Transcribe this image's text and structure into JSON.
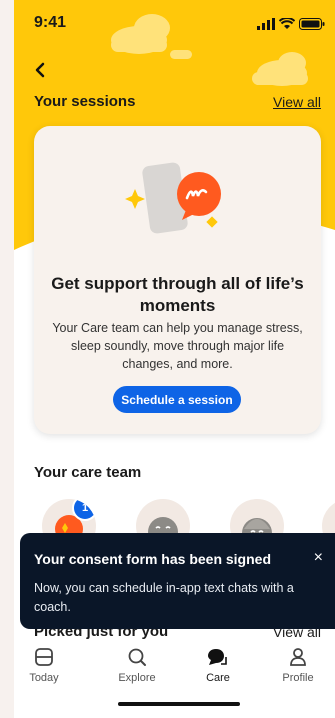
{
  "status_bar": {
    "time": "9:41"
  },
  "header": {
    "sessions_title": "Your sessions",
    "view_all": "View all"
  },
  "card": {
    "title": "Get support through all of life’s moments",
    "body": "Your Care team can help you manage stress, sleep soundly, move through major life changes, and more.",
    "button": "Schedule a session"
  },
  "team": {
    "title": "Your care team",
    "badge_count": "1"
  },
  "toast": {
    "title": "Your consent form has been signed",
    "body": "Now, you can schedule in-app text chats with a coach.",
    "close": "×"
  },
  "picked": {
    "title": "Picked just for you",
    "view_all": "View all"
  },
  "tabs": [
    {
      "label": "Today",
      "icon": "today-icon"
    },
    {
      "label": "Explore",
      "icon": "search-icon"
    },
    {
      "label": "Care",
      "icon": "chat-icon"
    },
    {
      "label": "Profile",
      "icon": "profile-icon"
    }
  ],
  "colors": {
    "hero_yellow": "#ffc80a",
    "accent_blue": "#0e64e6",
    "toast_bg": "#0a1628",
    "chat_orange": "#ff5a1f"
  }
}
